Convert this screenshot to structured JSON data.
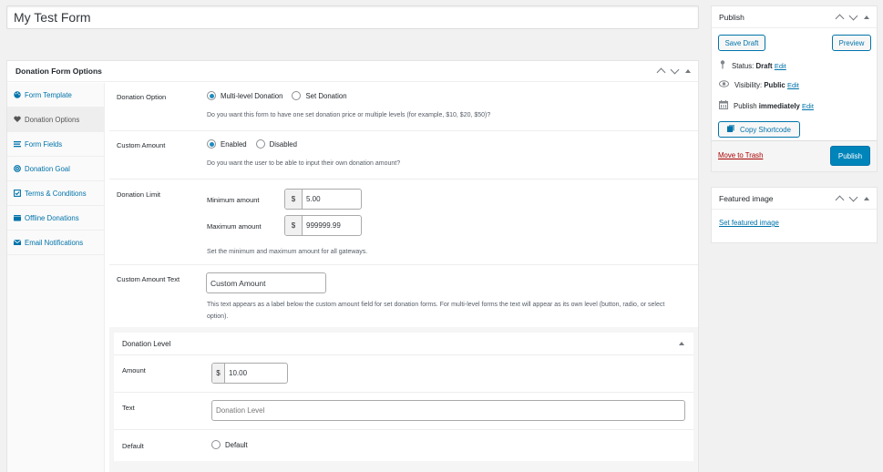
{
  "post_title": "My Test Form",
  "metabox": {
    "title": "Donation Form Options",
    "sidebar": [
      {
        "label": "Form Template",
        "icon": "palette-icon",
        "active": false
      },
      {
        "label": "Donation Options",
        "icon": "heart-icon",
        "active": true
      },
      {
        "label": "Form Fields",
        "icon": "list-icon",
        "active": false
      },
      {
        "label": "Donation Goal",
        "icon": "target-icon",
        "active": false
      },
      {
        "label": "Terms & Conditions",
        "icon": "checkbox-icon",
        "active": false
      },
      {
        "label": "Offline Donations",
        "icon": "wallet-icon",
        "active": false
      },
      {
        "label": "Email Notifications",
        "icon": "envelope-icon",
        "active": false
      }
    ],
    "donation_option": {
      "label": "Donation Option",
      "options": [
        "Multi-level Donation",
        "Set Donation"
      ],
      "selected": "Multi-level Donation",
      "description": "Do you want this form to have one set donation price or multiple levels (for example, $10, $20, $50)?"
    },
    "custom_amount": {
      "label": "Custom Amount",
      "options": [
        "Enabled",
        "Disabled"
      ],
      "selected": "Enabled",
      "description": "Do you want the user to be able to input their own donation amount?"
    },
    "donation_limit": {
      "label": "Donation Limit",
      "min_label": "Minimum amount",
      "min_value": "5.00",
      "max_label": "Maximum amount",
      "max_value": "999999.99",
      "currency": "$",
      "description": "Set the minimum and maximum amount for all gateways."
    },
    "custom_amount_text": {
      "label": "Custom Amount Text",
      "value": "Custom Amount",
      "description": "This text appears as a label below the custom amount field for set donation forms. For multi-level forms the text will appear as its own level (button, radio, or select option)."
    },
    "donation_level": {
      "title": "Donation Level",
      "amount_label": "Amount",
      "currency": "$",
      "amount_value": "10.00",
      "text_label": "Text",
      "text_placeholder": "Donation Level",
      "default_label": "Default",
      "default_option": "Default"
    }
  },
  "publish": {
    "title": "Publish",
    "save_draft": "Save Draft",
    "preview": "Preview",
    "status_label": "Status:",
    "status_value": "Draft",
    "visibility_label": "Visibility:",
    "visibility_value": "Public",
    "publish_label": "Publish",
    "publish_value": "immediately",
    "edit": "Edit",
    "copy_shortcode": "Copy Shortcode",
    "move_to_trash": "Move to Trash",
    "publish_button": "Publish"
  },
  "featured_image": {
    "title": "Featured image",
    "link": "Set featured image"
  }
}
